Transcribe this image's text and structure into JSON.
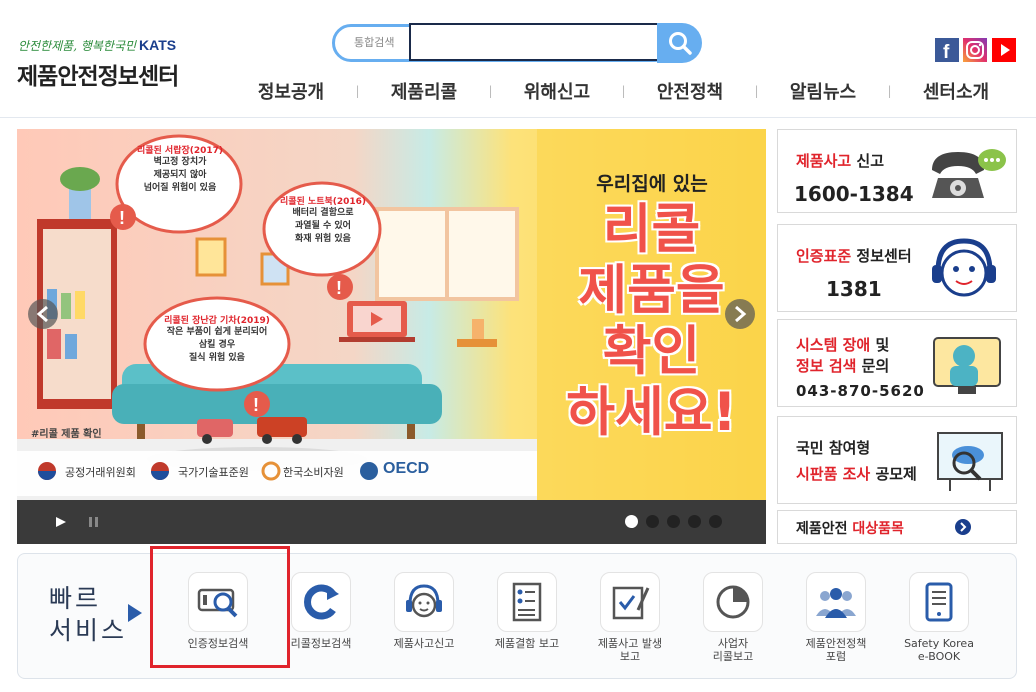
{
  "header": {
    "slogan": "안전한제품, 행복한국민",
    "brand": "KATS",
    "site_name": "제품안전정보센터",
    "search": {
      "label": "통합검색",
      "value": "",
      "icon": "search-icon"
    },
    "social": [
      {
        "name": "facebook-icon",
        "glyph": "f",
        "color": "#3b5998"
      },
      {
        "name": "instagram-icon",
        "glyph": "◎",
        "color": "#c13584"
      },
      {
        "name": "youtube-icon",
        "glyph": "▶",
        "color": "#ff0000"
      }
    ],
    "nav": [
      "정보공개",
      "제품리콜",
      "위해신고",
      "안전정책",
      "알림뉴스",
      "센터소개"
    ]
  },
  "banner": {
    "bubbles": [
      {
        "title": "리콜된 서랍장(2017)",
        "body": "벽고정 장치가\n제공되지 않아\n넘어질 위험이 있음"
      },
      {
        "title": "리콜된 노트북(2016)",
        "body": "배터리 결함으로\n과열될 수 있어\n화재 위험 있음"
      },
      {
        "title": "리콜된 장난감 기차(2019)",
        "body": "작은 부품이 쉽게 분리되어\n삼킬 경우\n질식 위험 있음"
      }
    ],
    "hashtag": "#리콜 제품 확인",
    "headline_small": "우리집에 있는",
    "headline_big": [
      "리콜",
      "제품을",
      "확인",
      "하세요!"
    ],
    "partners": [
      "공정거래위원회",
      "국가기술표준원",
      "한국소비자원",
      "OECD"
    ],
    "slide_count": 5,
    "active_slide": 1
  },
  "side": {
    "accident": {
      "red": "제품사고",
      "rest": " 신고",
      "number": "1600-1384"
    },
    "cert": {
      "red": "인증표준",
      "rest": " 정보센터",
      "number": "1381"
    },
    "system": {
      "red1": "시스템 장애",
      "rest1": " 및",
      "red2": "정보 검색",
      "rest2": " 문의",
      "number": "043-870-5620"
    },
    "survey": {
      "line1": "국민 참여형",
      "red": "시판품 조사",
      "rest": " 공모제"
    },
    "target": {
      "prefix": "제품안전 ",
      "red": "대상품목"
    }
  },
  "quick": {
    "title": "빠르\n서비스",
    "items": [
      {
        "name": "cert-info-search",
        "label": "인증정보검색",
        "icon": "magnifier-card-icon"
      },
      {
        "name": "recall-info-search",
        "label": "리콜정보검색",
        "icon": "recall-arrow-icon"
      },
      {
        "name": "accident-report",
        "label": "제품사고신고",
        "icon": "headset-icon"
      },
      {
        "name": "defect-report",
        "label": "제품결함 보고",
        "icon": "checklist-icon"
      },
      {
        "name": "accident-occur-report",
        "label": "제품사고 발생\n보고",
        "icon": "signed-document-icon"
      },
      {
        "name": "business-recall-report",
        "label": "사업자\n리콜보고",
        "icon": "pie-chart-icon"
      },
      {
        "name": "safety-policy-forum",
        "label": "제품안전정책\n포럼",
        "icon": "people-icon"
      },
      {
        "name": "safety-korea-ebook",
        "label": "Safety Korea\ne-BOOK",
        "icon": "tablet-icon"
      }
    ]
  },
  "colors": {
    "accent_blue": "#67aef0",
    "red": "#e0242c",
    "navy": "#1a2a4a"
  }
}
